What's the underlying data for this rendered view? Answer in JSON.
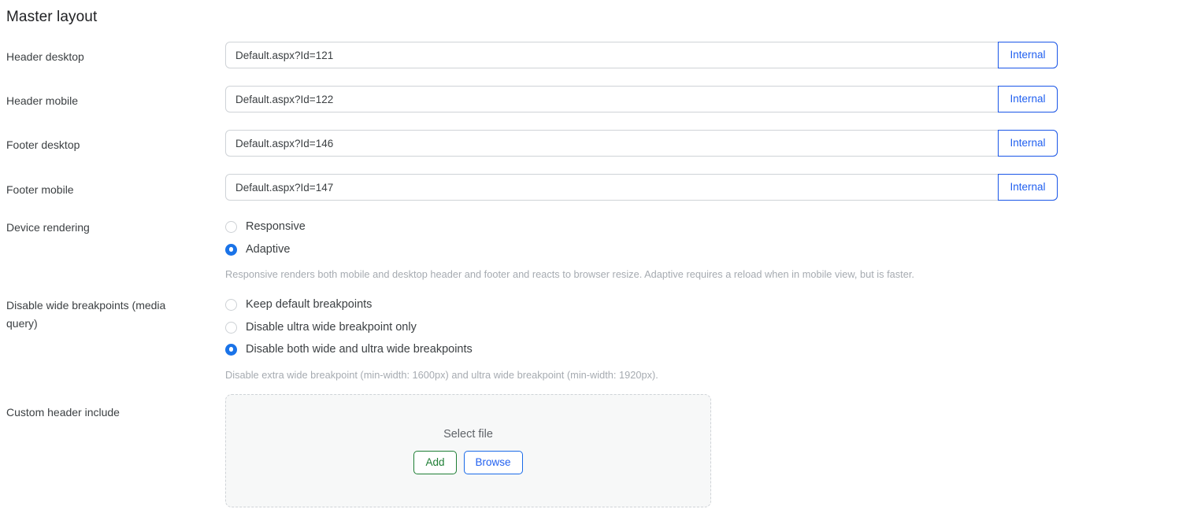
{
  "page": {
    "title": "Master layout"
  },
  "link_rows": [
    {
      "label": "Header desktop",
      "value": "Default.aspx?Id=121",
      "button_label": "Internal"
    },
    {
      "label": "Header mobile",
      "value": "Default.aspx?Id=122",
      "button_label": "Internal"
    },
    {
      "label": "Footer desktop",
      "value": "Default.aspx?Id=146",
      "button_label": "Internal"
    },
    {
      "label": "Footer mobile",
      "value": "Default.aspx?Id=147",
      "button_label": "Internal"
    }
  ],
  "device_rendering": {
    "label": "Device rendering",
    "options": [
      {
        "label": "Responsive",
        "selected": false
      },
      {
        "label": "Adaptive",
        "selected": true
      }
    ],
    "hint": "Responsive renders both mobile and desktop header and footer and reacts to browser resize. Adaptive requires a reload when in mobile view, but is faster."
  },
  "breakpoints": {
    "label": "Disable wide breakpoints (media query)",
    "options": [
      {
        "label": "Keep default breakpoints",
        "selected": false
      },
      {
        "label": "Disable ultra wide breakpoint only",
        "selected": false
      },
      {
        "label": "Disable both wide and ultra wide breakpoints",
        "selected": true
      }
    ],
    "hint": "Disable extra wide breakpoint (min-width: 1600px) and ultra wide breakpoint (min-width: 1920px)."
  },
  "custom_header_include": {
    "label": "Custom header include",
    "dropzone_text": "Select file",
    "add_label": "Add",
    "browse_label": "Browse"
  },
  "colors": {
    "accent_blue": "#1a73e8",
    "button_blue": "#2160f0",
    "add_green": "#1e7e34",
    "hint_gray": "#a6abb1",
    "border_gray": "#cfd3d7"
  }
}
